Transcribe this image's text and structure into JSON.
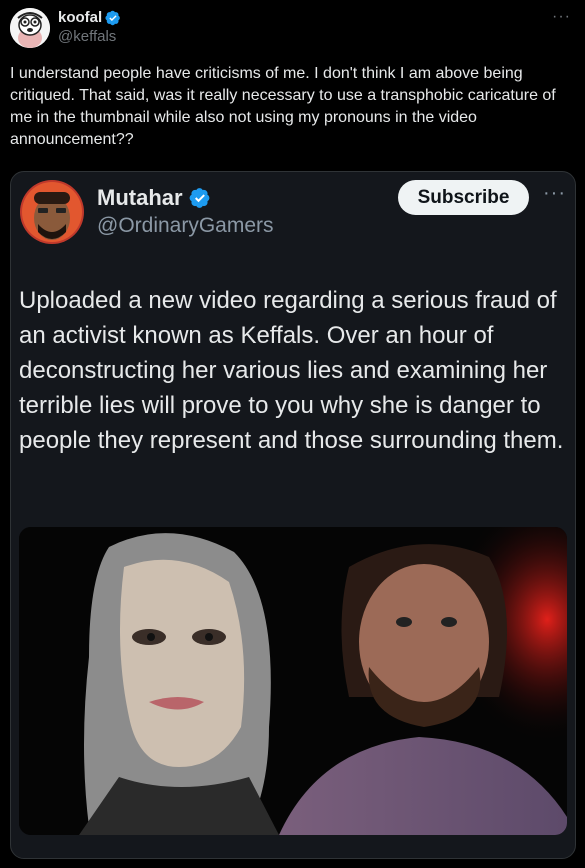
{
  "post": {
    "display_name": "koofal",
    "handle": "@keffals",
    "more": "···",
    "text": "I understand people have criticisms of me. I don't think I am above being critiqued. That said, was it really necessary to use a transphobic caricature of me in the thumbnail while also not using my pronouns in the video announcement??"
  },
  "quote": {
    "display_name": "Mutahar",
    "handle": "@OrdinaryGamers",
    "subscribe_label": "Subscribe",
    "more": "···",
    "text": "Uploaded a new video regarding a serious fraud of an activist known as Keffals. Over an hour of deconstructing her various lies and examining her terrible lies will prove to you why she is danger to people they represent and those surrounding them."
  },
  "colors": {
    "verified": "#1d9bf0",
    "background": "#000000",
    "card_background": "#14171c"
  },
  "icons": {
    "verified": "verified-badge-icon",
    "more": "more-horizontal-icon"
  }
}
